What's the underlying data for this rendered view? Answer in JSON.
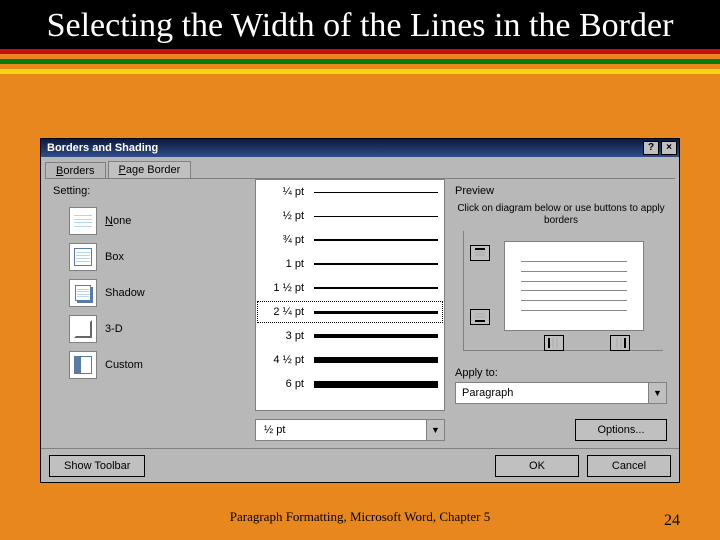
{
  "slide": {
    "title": "Selecting the Width of the Lines in the Border",
    "footer_text": "Paragraph Formatting, Microsoft Word, Chapter 5",
    "page_number": "24"
  },
  "dialog": {
    "title": "Borders and Shading",
    "tabs": [
      "Borders",
      "Page Border"
    ],
    "active_tab": 0,
    "setting_label": "Setting:",
    "settings": [
      {
        "label": "None"
      },
      {
        "label": "Box"
      },
      {
        "label": "Shadow"
      },
      {
        "label": "3-D"
      },
      {
        "label": "Custom"
      }
    ],
    "width_options": [
      "¼ pt",
      "½ pt",
      "¾ pt",
      "1 pt",
      "1 ½ pt",
      "2 ¼ pt",
      "3 pt",
      "4 ½ pt",
      "6 pt"
    ],
    "width_selected_index": 5,
    "width_field_value": "½ pt",
    "preview_label": "Preview",
    "preview_hint": "Click on diagram below or use buttons to apply borders",
    "apply_to_label": "Apply to:",
    "apply_to_value": "Paragraph",
    "options_btn": "Options...",
    "show_toolbar_btn": "Show Toolbar",
    "ok_btn": "OK",
    "cancel_btn": "Cancel"
  }
}
